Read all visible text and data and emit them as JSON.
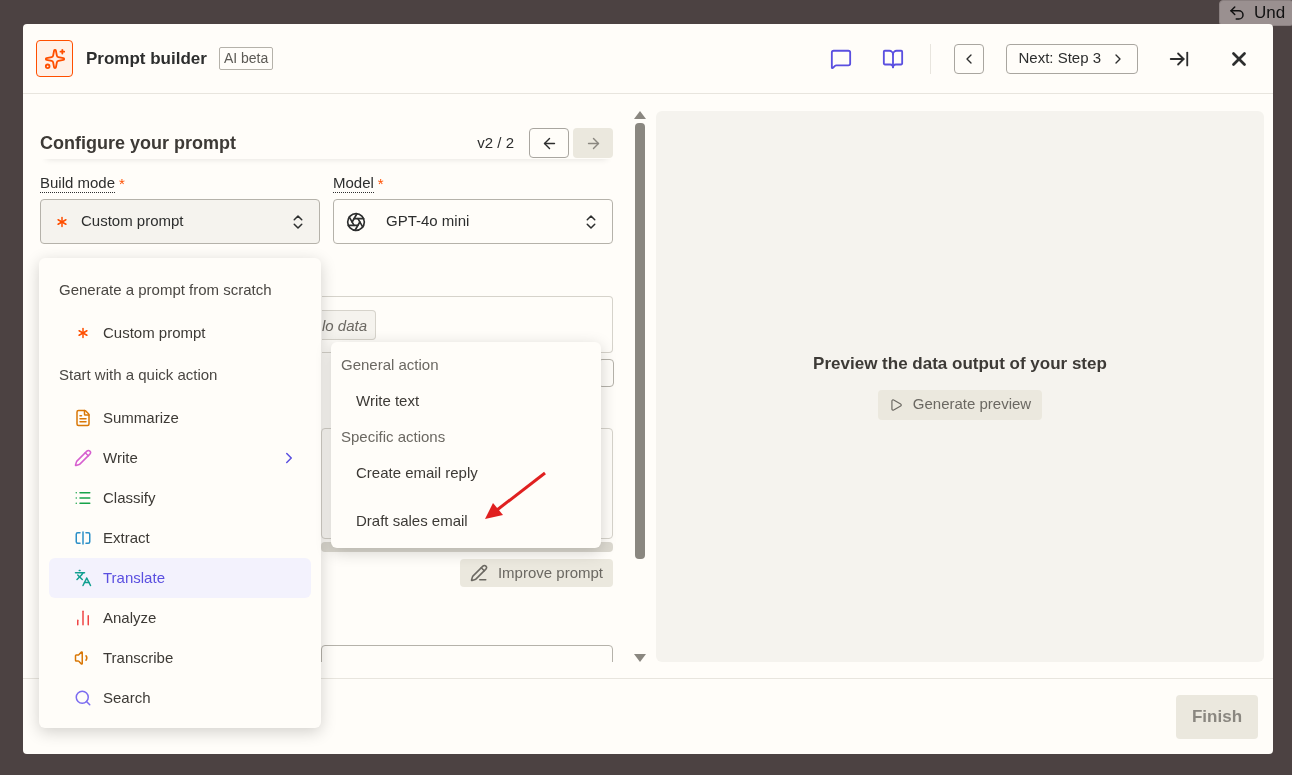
{
  "background": {
    "undo_button": "Und"
  },
  "header": {
    "title": "Prompt builder",
    "badge": "AI beta",
    "next_button": "Next: Step 3"
  },
  "configure": {
    "title": "Configure your prompt",
    "version": "v2 / 2",
    "next_disabled": true
  },
  "build_mode": {
    "label": "Build mode",
    "required_mark": "*",
    "value": "Custom prompt"
  },
  "model": {
    "label": "Model",
    "required_mark": "*",
    "value": "GPT-4o mini"
  },
  "hidden_fragments": {
    "pill": "lo data"
  },
  "improve_button": "Improve prompt",
  "preview": {
    "title": "Preview the data output of your step",
    "button": "Generate preview"
  },
  "footer": {
    "finish_button": "Finish"
  },
  "build_menu": {
    "sections": [
      {
        "heading": "Generate a prompt from scratch",
        "items": [
          {
            "label": "Custom prompt",
            "kind": "asterisk",
            "selected": false,
            "expanded": false
          }
        ]
      },
      {
        "heading": "Start with a quick action",
        "items": [
          {
            "label": "Summarize",
            "kind": "summarize",
            "selected": false,
            "expanded": false
          },
          {
            "label": "Write",
            "kind": "write",
            "selected": false,
            "expanded": true
          },
          {
            "label": "Classify",
            "kind": "classify",
            "selected": false,
            "expanded": false
          },
          {
            "label": "Extract",
            "kind": "extract",
            "selected": false,
            "expanded": false
          },
          {
            "label": "Translate",
            "kind": "translate",
            "selected": true,
            "expanded": false
          },
          {
            "label": "Analyze",
            "kind": "analyze",
            "selected": false,
            "expanded": false
          },
          {
            "label": "Transcribe",
            "kind": "transcribe",
            "selected": false,
            "expanded": false
          },
          {
            "label": "Search",
            "kind": "search",
            "selected": false,
            "expanded": false
          }
        ]
      }
    ]
  },
  "submenu": {
    "sections": [
      {
        "heading": "General action",
        "items": [
          "Write text"
        ]
      },
      {
        "heading": "Specific actions",
        "items": [
          "Create email reply",
          "Draft sales email"
        ]
      }
    ]
  }
}
